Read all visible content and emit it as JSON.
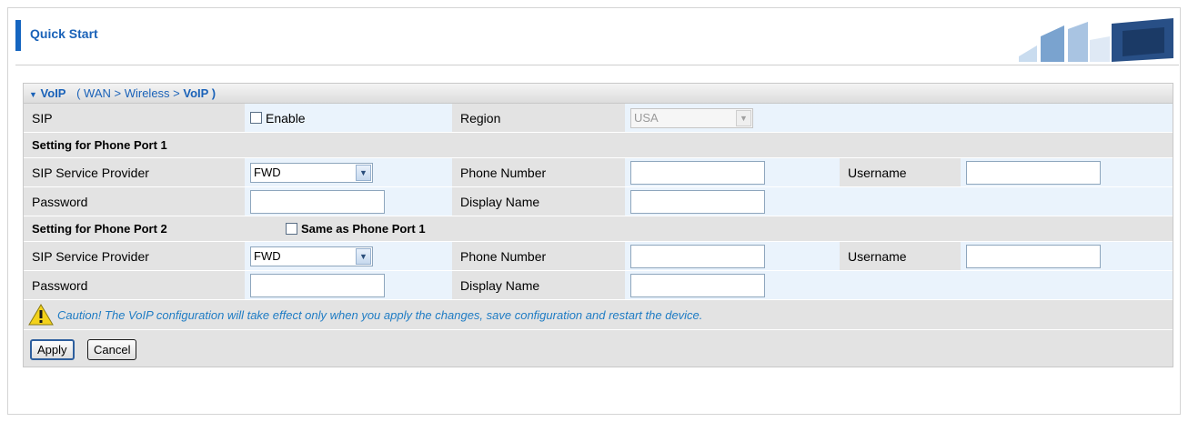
{
  "header": {
    "title": "Quick Start"
  },
  "panel": {
    "title": "VoIP",
    "crumb_prefix": "( WAN > Wireless >",
    "crumb_current": "VoIP )"
  },
  "sip_row": {
    "sip_label": "SIP",
    "enable_label": "Enable",
    "enable_checked": false,
    "region_label": "Region",
    "region_value": "USA"
  },
  "port1": {
    "section_label": "Setting for Phone Port 1",
    "provider_label": "SIP Service Provider",
    "provider_value": "FWD",
    "phone_label": "Phone Number",
    "phone_value": "",
    "username_label": "Username",
    "username_value": "",
    "password_label": "Password",
    "password_value": "",
    "display_label": "Display Name",
    "display_value": ""
  },
  "port2": {
    "section_label": "Setting for Phone Port 2",
    "same_label": "Same as Phone Port 1",
    "same_checked": false,
    "provider_label": "SIP Service Provider",
    "provider_value": "FWD",
    "phone_label": "Phone Number",
    "phone_value": "",
    "username_label": "Username",
    "username_value": "",
    "password_label": "Password",
    "password_value": "",
    "display_label": "Display Name",
    "display_value": ""
  },
  "caution": "Caution! The VoIP configuration will take effect only when you apply the changes, save configuration and restart the device.",
  "buttons": {
    "apply": "Apply",
    "cancel": "Cancel"
  },
  "colors": {
    "accent": "#1565c0",
    "link_blue": "#1a62b8",
    "caution_text": "#1f7cc4",
    "row_bg": "#eaf3fc",
    "label_bg": "#e3e3e3"
  },
  "icons": {
    "warning": "warning-triangle-icon",
    "dropdown": "chevron-down-icon",
    "collapse": "triangle-down-icon"
  }
}
